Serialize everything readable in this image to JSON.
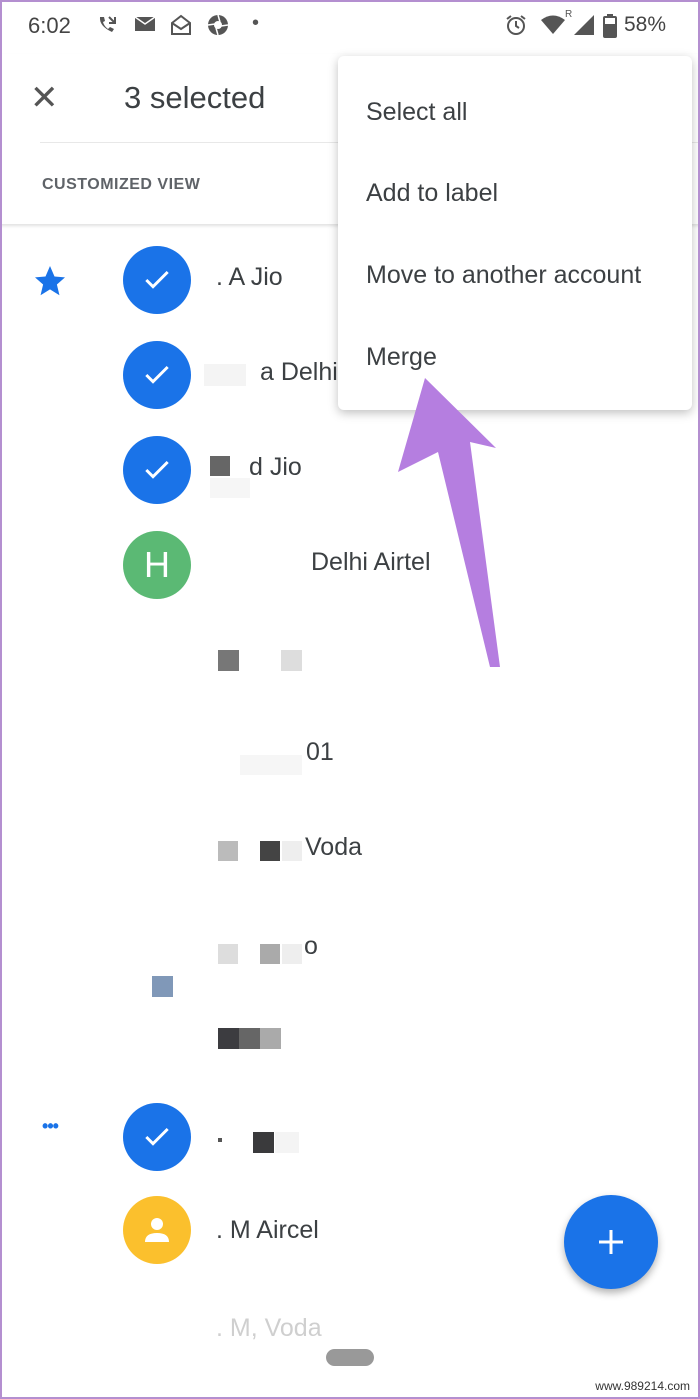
{
  "status_bar": {
    "time": "6:02",
    "left_icons": [
      "missed-call-icon",
      "mail-icon",
      "open-mail-icon",
      "aperture-icon",
      "dot-icon"
    ],
    "right_icons": [
      "alarm-icon",
      "wifi-icon",
      "signal-icon",
      "battery-icon"
    ],
    "roaming": "R",
    "battery": "58%"
  },
  "toolbar": {
    "close_icon": "close-icon",
    "title": "3 selected",
    "view_label": "CUSTOMIZED VIEW"
  },
  "menu": {
    "items": [
      {
        "label": "Select all"
      },
      {
        "label": "Add to label"
      },
      {
        "label": "Move to another account"
      },
      {
        "label": "Merge"
      }
    ]
  },
  "contacts": [
    {
      "lead": "star-icon",
      "avatar": "check",
      "name": ". A Jio",
      "selected": true
    },
    {
      "lead": "",
      "avatar": "check",
      "name": "a Delhi",
      "selected": true
    },
    {
      "lead": "",
      "avatar": "check",
      "name": "d Jio",
      "selected": true
    },
    {
      "lead": "",
      "avatar": "letter",
      "letter": "H",
      "name": "Delhi Airtel",
      "selected": false
    },
    {
      "lead": "",
      "avatar": "pixelated",
      "name": "",
      "selected": false
    },
    {
      "lead": "",
      "avatar": "pixelated",
      "name": "01",
      "selected": false
    },
    {
      "lead": "",
      "avatar": "pixelated",
      "name": "Voda",
      "selected": false
    },
    {
      "lead": "",
      "avatar": "pixelated",
      "name": "o",
      "selected": false
    },
    {
      "lead": "",
      "avatar": "pixelated",
      "name": "",
      "selected": false
    },
    {
      "lead": "more-icon",
      "avatar": "check",
      "name": "",
      "selected": true
    },
    {
      "lead": "",
      "avatar": "person",
      "name": ". M Aircel",
      "selected": false
    },
    {
      "lead": "",
      "avatar": "pixelated",
      "name": ". M, Voda",
      "selected": false
    }
  ],
  "colors": {
    "accent": "#1a73e8",
    "avatar_green": "#5bb974",
    "avatar_yellow": "#fbc02d",
    "annotation_arrow": "#b57ee0"
  },
  "fab": {
    "icon": "plus-icon"
  },
  "watermark": "www.989214.com"
}
